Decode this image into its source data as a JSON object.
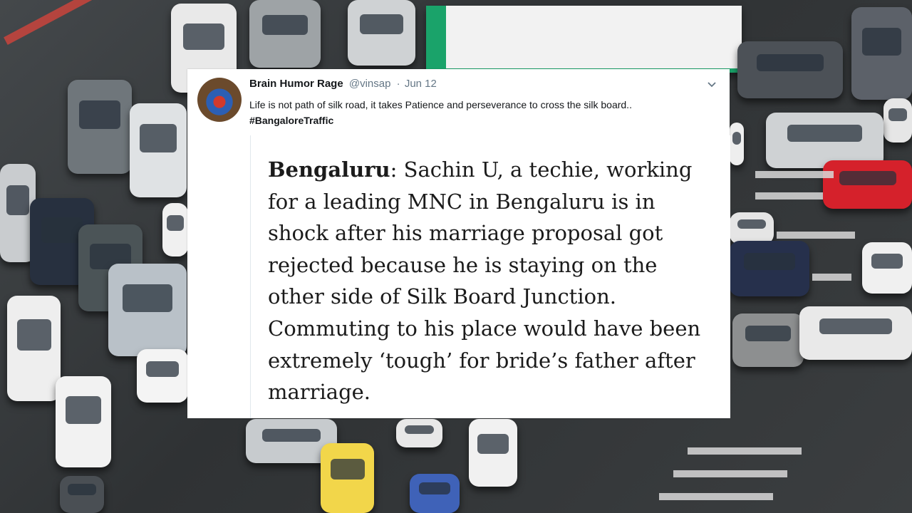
{
  "tweet": {
    "author_name": "Brain Humor Rage",
    "handle": "@vinsap",
    "separator": "·",
    "date": "Jun 12",
    "text": "Life is not path of silk road, it takes Patience and perseverance to cross the silk board..",
    "hashtag": "#BangaloreTraffic",
    "menu_icon": "chevron-down-icon"
  },
  "article": {
    "lead": "Bengaluru",
    "body": ": Sachin U, a techie, working for a leading MNC in Bengaluru is in shock after his marriage proposal got rejected because he is staying on the other side of Silk Board Junction. Commuting to his place would have been extremely ‘tough’ for bride’s father after marriage."
  },
  "colors": {
    "card_bg": "#ffffff",
    "text": "#14171a",
    "muted": "#657786",
    "bus_green": "#1aa36a"
  }
}
